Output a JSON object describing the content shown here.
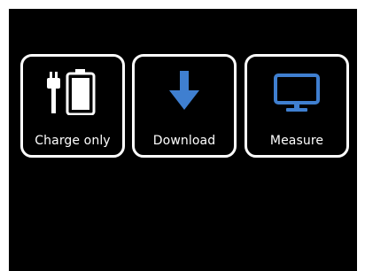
{
  "modes": [
    {
      "label": "Charge only",
      "icon": "plug-battery-icon"
    },
    {
      "label": "Download",
      "icon": "download-arrow-icon"
    },
    {
      "label": "Measure",
      "icon": "monitor-icon"
    }
  ],
  "colors": {
    "screen_background": "#000000",
    "button_border": "#ffffff",
    "label_text": "#ffffff",
    "charge_icon": "#ffffff",
    "accent_icon": "#3f7fd0"
  }
}
